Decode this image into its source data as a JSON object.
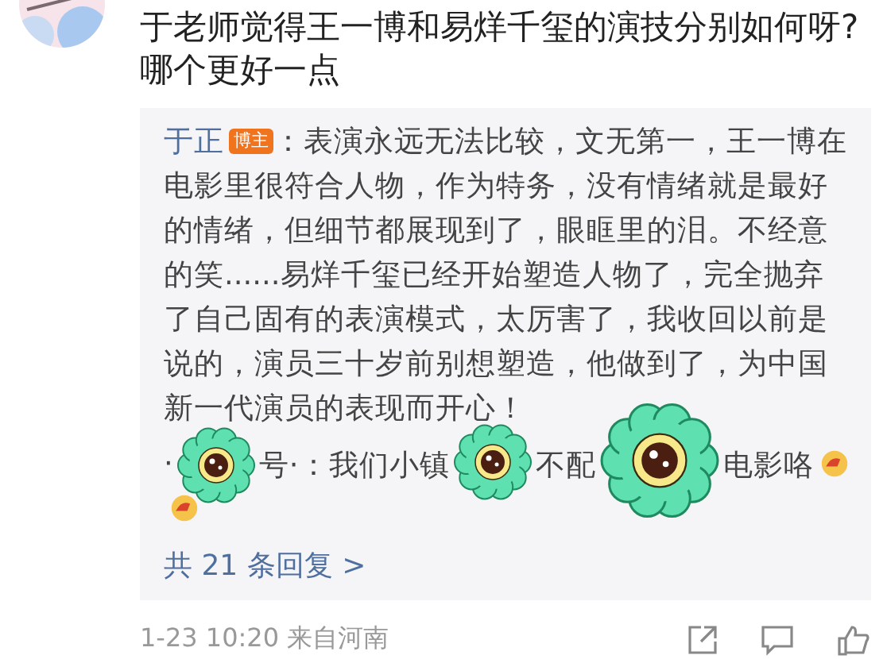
{
  "comment": {
    "text": "于老师觉得王一博和易烊千玺的演技分别如何呀?哪个更好一点"
  },
  "reply": {
    "author": "于正",
    "badge": "博主",
    "text": "：表演永远无法比较，文无第一，王一博在电影里很符合人物，作为特务，没有情绪就是最好的情绪，但细节都展现到了，眼眶里的泪。不经意的笑......易烊千玺已经开始塑造人物了，完全抛弃了自己固有的表演模式，太厉害了，我收回以前是说的，演员三十岁前别想塑造，他做到了，为中国新一代演员的表现而开心！"
  },
  "sub_reply": {
    "segments": [
      "·",
      "号·：我们小镇",
      "不配",
      "电影咯"
    ]
  },
  "replies_link": "共 21 条回复 >",
  "footer": {
    "time": "1-23 10:20  来自河南"
  }
}
